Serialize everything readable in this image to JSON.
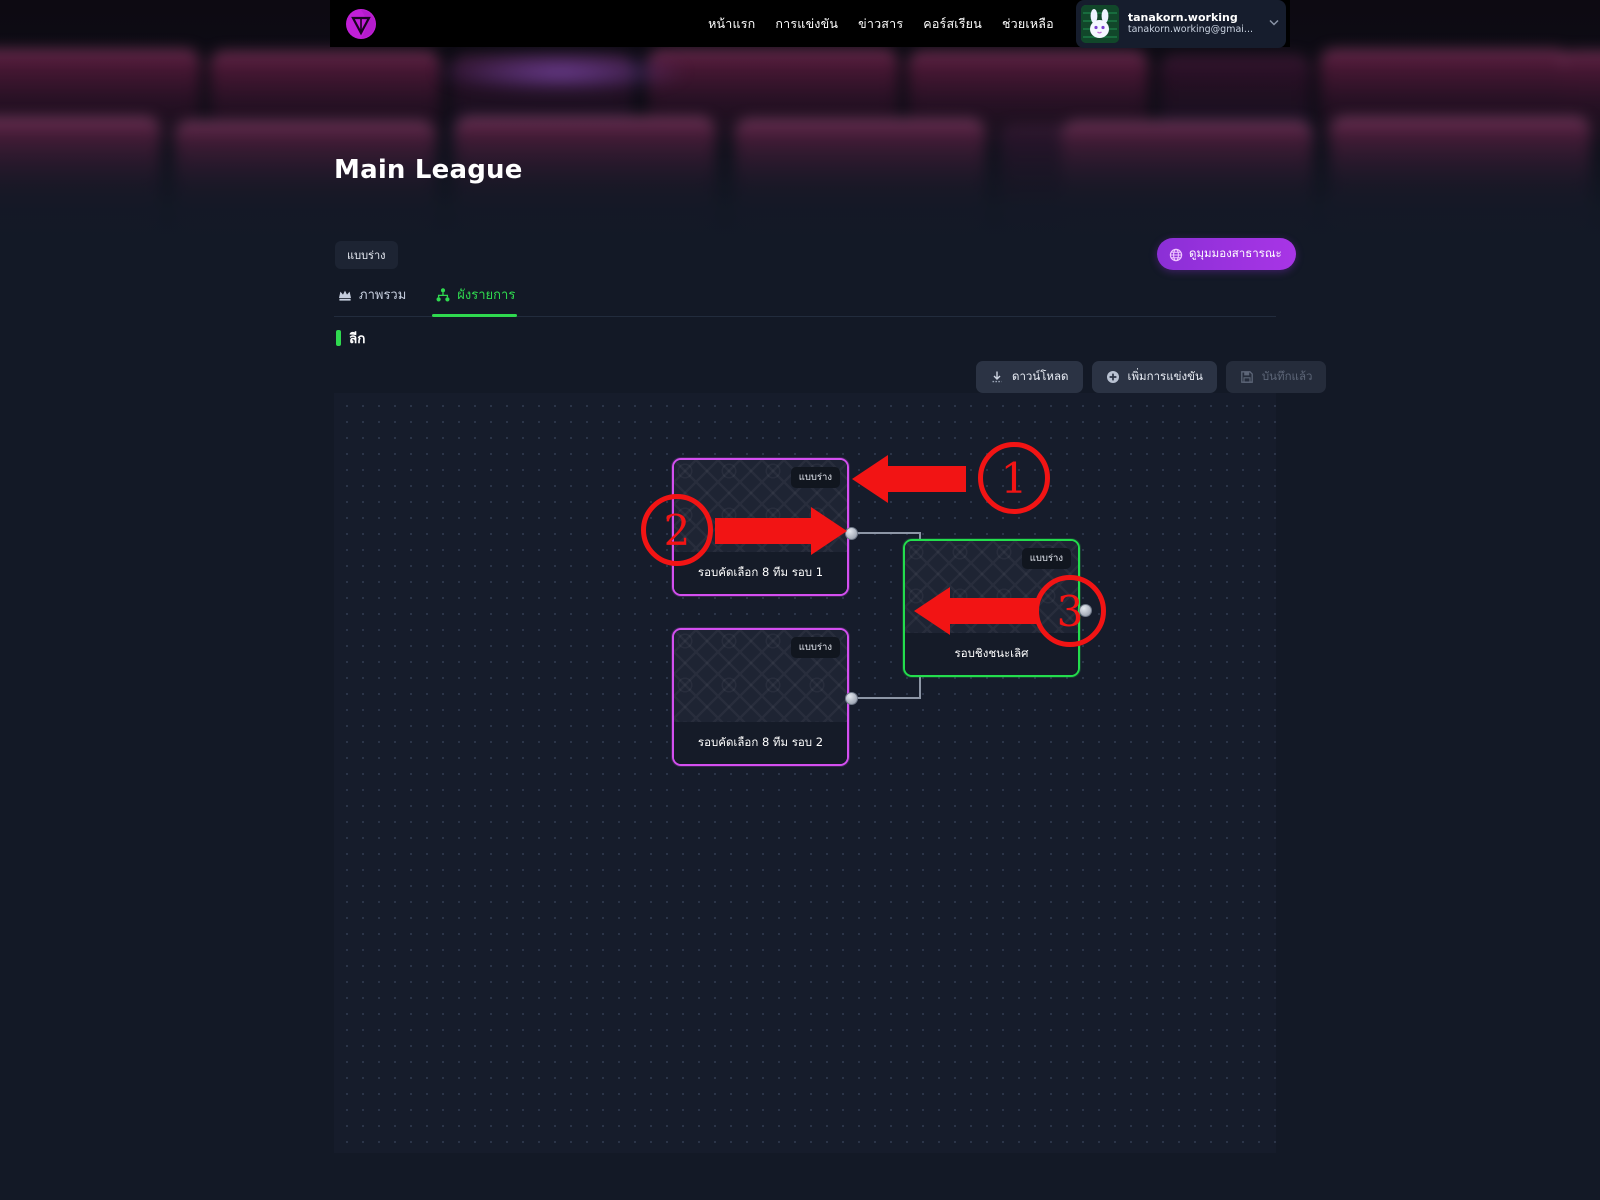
{
  "navbar": {
    "logo_icon": "v-logo-icon",
    "links": [
      {
        "label": "หน้าแรก"
      },
      {
        "label": "การแข่งขัน"
      },
      {
        "label": "ข่าวสาร"
      },
      {
        "label": "คอร์สเรียน"
      },
      {
        "label": "ช่วยเหลือ"
      }
    ],
    "user": {
      "username": "tanakorn.working",
      "email": "tanakorn.working@gmai...",
      "avatar_icon": "rabbit-avatar",
      "caret_icon": "chevron-down-icon"
    }
  },
  "page": {
    "title": "Main League",
    "status_badge": "แบบร่าง",
    "public_view_button": "ดูมุมมองสาธารณะ",
    "globe_icon": "globe-icon",
    "section_label": "ลีก"
  },
  "tabs": [
    {
      "label": "ภาพรวม",
      "icon": "crown-icon",
      "active": false
    },
    {
      "label": "ผังรายการ",
      "icon": "sitemap-icon",
      "active": true
    }
  ],
  "actions": [
    {
      "label": "ดาวน์โหลด",
      "icon": "download-icon",
      "disabled": false
    },
    {
      "label": "เพิ่มการแข่งขัน",
      "icon": "plus-circle-icon",
      "disabled": false
    },
    {
      "label": "บันทึกแล้ว",
      "icon": "save-icon",
      "disabled": true
    }
  ],
  "bracket": {
    "nodes": [
      {
        "id": "qualifier-1",
        "title": "รอบคัดเลือก 8 ทีม รอบ 1",
        "badge": "แบบร่าง",
        "color": "purple"
      },
      {
        "id": "qualifier-2",
        "title": "รอบคัดเลือก 8 ทีม รอบ 2",
        "badge": "แบบร่าง",
        "color": "purple"
      },
      {
        "id": "final",
        "title": "รอบชิงชนะเลิศ",
        "badge": "แบบร่าง",
        "color": "green"
      }
    ]
  },
  "annotations": [
    {
      "number": "1"
    },
    {
      "number": "2"
    },
    {
      "number": "3"
    }
  ],
  "colors": {
    "accent_purple": "#a835e6",
    "accent_green": "#2fd94f",
    "node_purple": "#d44ff0",
    "node_green": "#23dd4d",
    "annotation_red": "#f21414",
    "canvas_bg": "#161c2b"
  }
}
